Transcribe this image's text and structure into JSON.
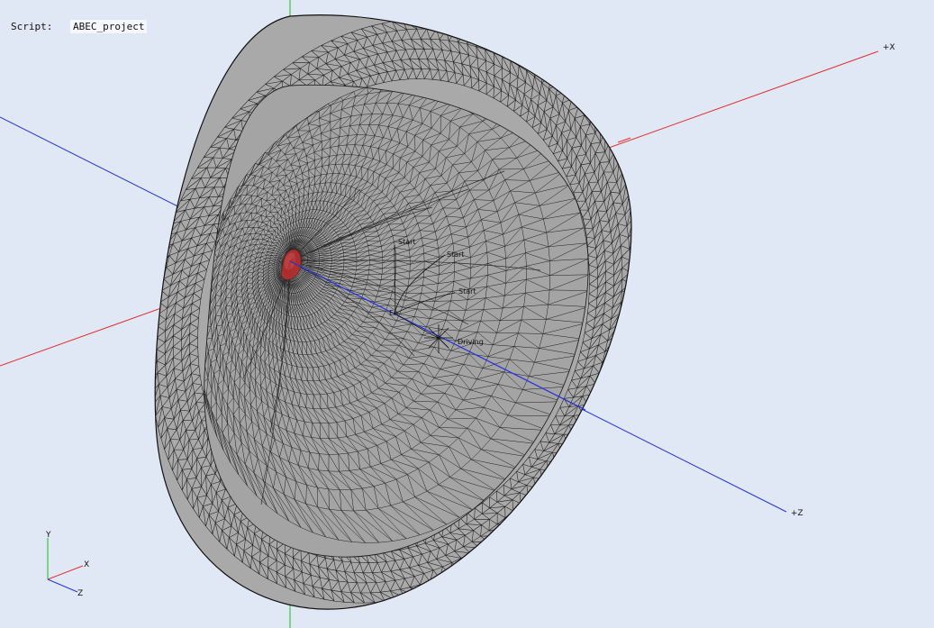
{
  "header": {
    "script_label": "Script:",
    "script_value": "ABEC_project"
  },
  "axes": {
    "x_label": "+X",
    "z_label": "+Z"
  },
  "mini_axes": {
    "x": "X",
    "y": "Y",
    "z": "Z"
  },
  "mesh_labels": {
    "start_1": "Start",
    "start_2": "Start",
    "start_3": "Start",
    "driving": "Driving",
    "end": "En"
  },
  "colors": {
    "background": "#dfe8f4",
    "axis_x": "#e03030",
    "axis_y": "#22bb22",
    "axis_z": "#2233dd",
    "mesh_fill": "#a9a9a9",
    "mesh_line": "#1a1a1a",
    "driving_zone": "#c03030"
  }
}
